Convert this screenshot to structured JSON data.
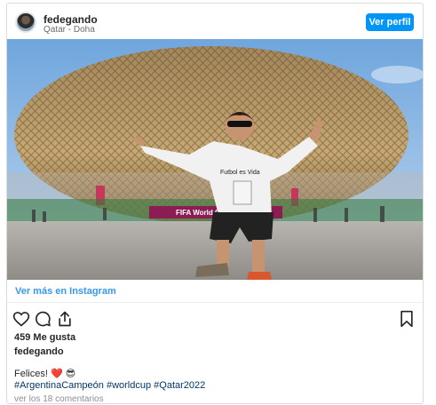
{
  "header": {
    "username": "fedegando",
    "location": "Qatar - Doha",
    "view_profile_label": "Ver perfil"
  },
  "photo": {
    "banner_text": "FIFA World Cup",
    "shirt_text": "Futbol es Vida",
    "alt": "Photo"
  },
  "links": {
    "view_more_label": "Ver más en Instagram"
  },
  "actions": {
    "icons": [
      "heart-icon",
      "comment-icon",
      "share-icon",
      "bookmark-icon"
    ]
  },
  "post": {
    "likes": "459 Me gusta",
    "author": "fedegando",
    "caption_text": "Felices!",
    "caption_emojis": "❤️ 😎",
    "hashtags": [
      "#ArgentinaCampeón",
      "#worldcup",
      "#Qatar2022"
    ],
    "comments_label": "ver los 18 comentarios"
  },
  "colors": {
    "accent": "#0095f6",
    "link": "#3897f0",
    "hashtag": "#00376b",
    "muted": "#8e8e8e"
  }
}
